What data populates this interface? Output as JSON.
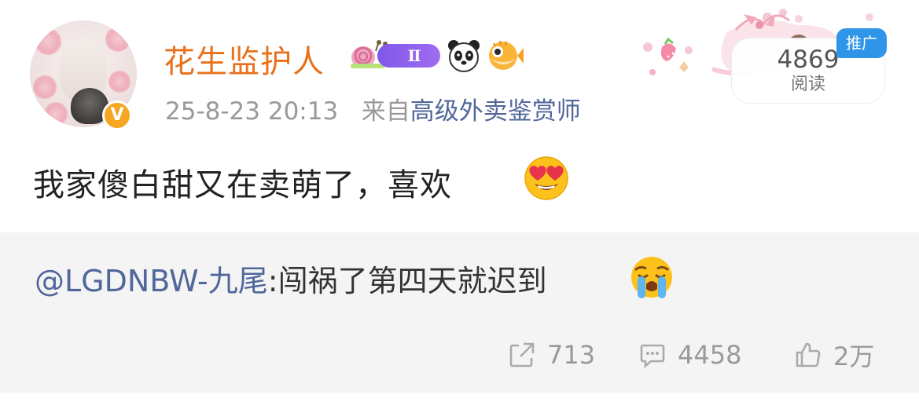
{
  "post": {
    "username": "花生监护人",
    "level_badge": "Ⅱ",
    "timestamp": "25-8-23 20:13",
    "source_prefix": "来自",
    "source_name": "高级外卖鉴赏师",
    "read_count": "4869",
    "read_label": "阅读",
    "promo_label": "推广",
    "verified_icon": "v-badge-icon",
    "text": "我家傻白甜又在卖萌了，喜欢",
    "text_emoji": "heart-eyes-icon"
  },
  "repost": {
    "mention": "@LGDNBW-九尾",
    "text": ":闯祸了第四天就迟到",
    "emoji": "crying-face-icon"
  },
  "actions": {
    "repost_count": "713",
    "comment_count": "4458",
    "like_count": "2万"
  },
  "colors": {
    "username": "#e8711b",
    "link": "#51679a",
    "promo": "#2f95e8",
    "verify": "#f5a623",
    "level_badge": "#8a5cf0",
    "panel_bg": "#f4f4f4"
  }
}
